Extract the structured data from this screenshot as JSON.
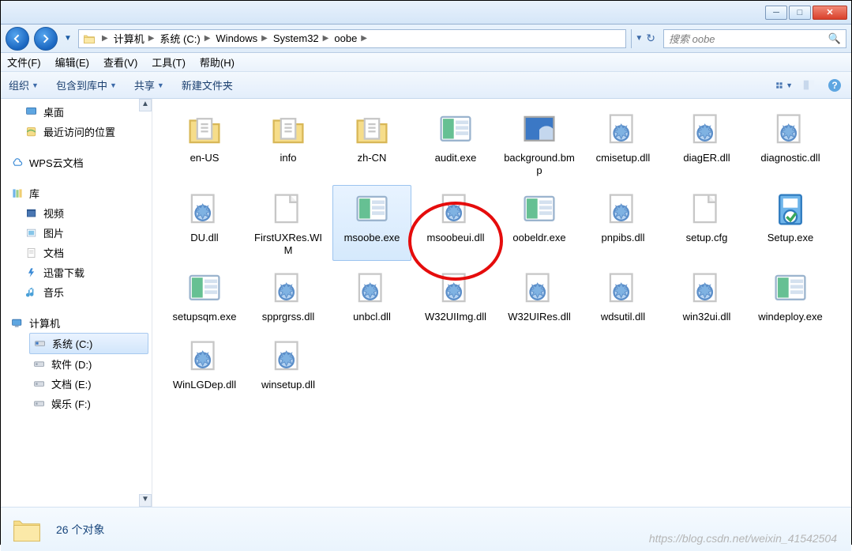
{
  "titlebar": {
    "min": "─",
    "max": "□",
    "close": "✕"
  },
  "nav": {
    "breadcrumbs": [
      "计算机",
      "系统 (C:)",
      "Windows",
      "System32",
      "oobe"
    ],
    "search_placeholder": "搜索 oobe"
  },
  "menubar": {
    "file": "文件(F)",
    "edit": "编辑(E)",
    "view": "查看(V)",
    "tools": "工具(T)",
    "help": "帮助(H)"
  },
  "toolbar": {
    "organize": "组织",
    "include": "包含到库中",
    "share": "共享",
    "newfolder": "新建文件夹"
  },
  "tree": {
    "desktop": "桌面",
    "recent": "最近访问的位置",
    "wps": "WPS云文档",
    "libraries": "库",
    "videos": "视频",
    "pictures": "图片",
    "documents": "文档",
    "xunlei": "迅雷下载",
    "music": "音乐",
    "computer": "计算机",
    "drive_c": "系统 (C:)",
    "drive_d": "软件 (D:)",
    "drive_e": "文档 (E:)",
    "drive_f": "娱乐 (F:)"
  },
  "files": [
    {
      "name": "en-US",
      "type": "folder"
    },
    {
      "name": "info",
      "type": "folder",
      "circled": true
    },
    {
      "name": "zh-CN",
      "type": "folder"
    },
    {
      "name": "audit.exe",
      "type": "exe-img"
    },
    {
      "name": "background.bmp",
      "type": "bmp"
    },
    {
      "name": "cmisetup.dll",
      "type": "dll"
    },
    {
      "name": "diagER.dll",
      "type": "dll"
    },
    {
      "name": "diagnostic.dll",
      "type": "dll"
    },
    {
      "name": "DU.dll",
      "type": "dll"
    },
    {
      "name": "FirstUXRes.WIM",
      "type": "file"
    },
    {
      "name": "msoobe.exe",
      "type": "exe-img",
      "selected": true
    },
    {
      "name": "msoobeui.dll",
      "type": "dll"
    },
    {
      "name": "oobeldr.exe",
      "type": "exe-img"
    },
    {
      "name": "pnpibs.dll",
      "type": "dll"
    },
    {
      "name": "setup.cfg",
      "type": "file"
    },
    {
      "name": "Setup.exe",
      "type": "exe-setup"
    },
    {
      "name": "setupsqm.exe",
      "type": "exe-img"
    },
    {
      "name": "spprgrss.dll",
      "type": "dll"
    },
    {
      "name": "unbcl.dll",
      "type": "dll"
    },
    {
      "name": "W32UIImg.dll",
      "type": "dll"
    },
    {
      "name": "W32UIRes.dll",
      "type": "dll"
    },
    {
      "name": "wdsutil.dll",
      "type": "dll"
    },
    {
      "name": "win32ui.dll",
      "type": "dll"
    },
    {
      "name": "windeploy.exe",
      "type": "exe-img"
    },
    {
      "name": "WinLGDep.dll",
      "type": "dll"
    },
    {
      "name": "winsetup.dll",
      "type": "dll"
    }
  ],
  "status": {
    "count": "26 个对象"
  },
  "watermark": "https://blog.csdn.net/weixin_41542504"
}
